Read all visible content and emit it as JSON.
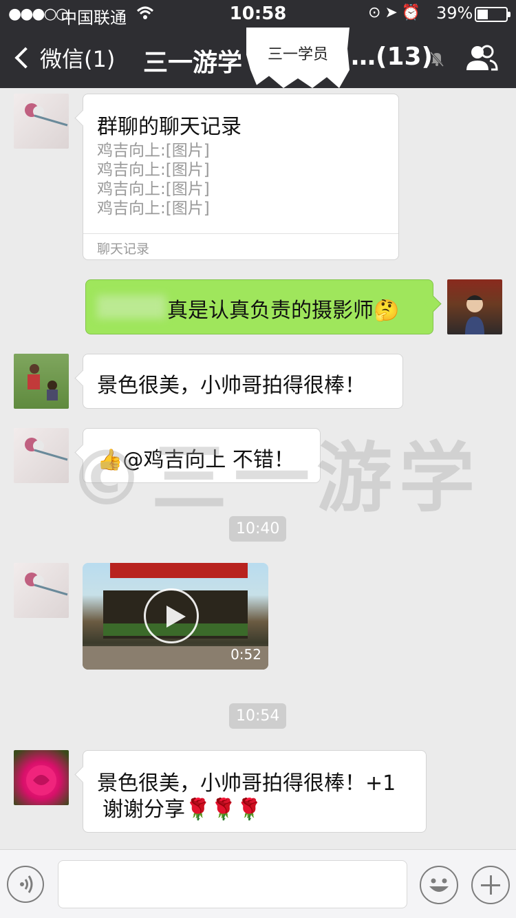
{
  "status_bar": {
    "signal": "●●●○○",
    "carrier": "中国联通",
    "time": "10:58",
    "battery_percent": "39%"
  },
  "nav": {
    "back_label": "微信(1)",
    "title": "三一游学",
    "member_count": "…(13)"
  },
  "sticker_label": "三一学员",
  "watermark": "©三一游学",
  "messages": {
    "record": {
      "title": "群聊的聊天记录",
      "lines": [
        "鸡吉向上:[图片]",
        "鸡吉向上:[图片]",
        "鸡吉向上:[图片]",
        "鸡吉向上:[图片]"
      ],
      "footer": "聊天记录"
    },
    "self_msg": "真是认真负责的摄影师🤔",
    "msg1": "景色很美，小帅哥拍得很棒！",
    "msg2": "👍@鸡吉向上 不错！",
    "timestamp1": "10:40",
    "video_duration": "0:52",
    "timestamp2": "10:54",
    "msg3_line1": "景色很美，小帅哥拍得很棒！+1",
    "msg3_line2": "谢谢分享🌹🌹🌹"
  },
  "colors": {
    "bar": "#2e2e32",
    "self_bubble": "#9fe65c",
    "background": "#ebebeb"
  }
}
